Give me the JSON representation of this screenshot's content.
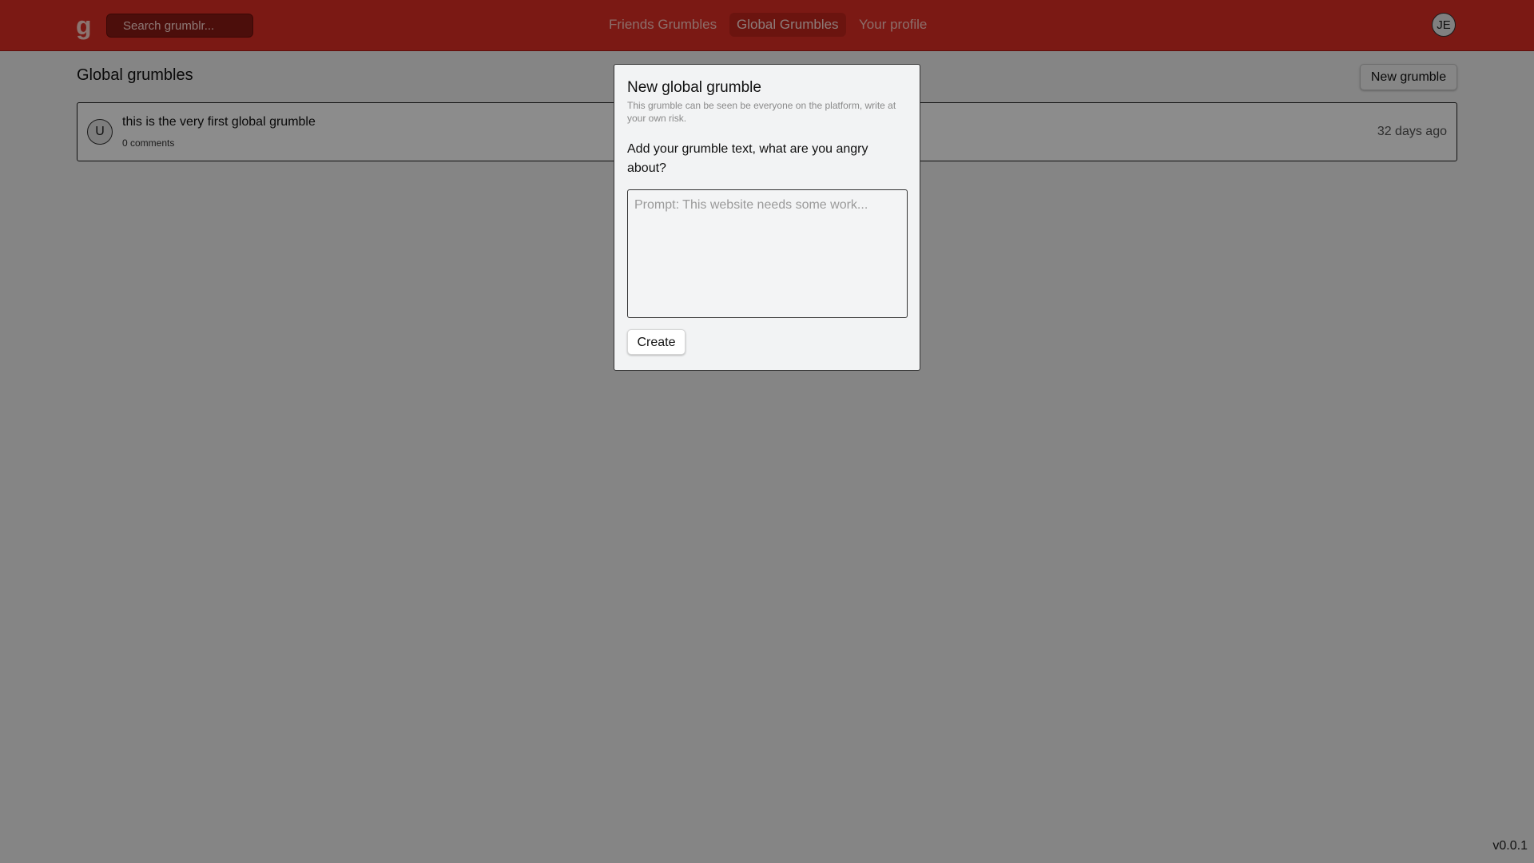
{
  "header": {
    "logo": "g",
    "search_placeholder": "Search grumblr...",
    "nav": [
      {
        "label": "Friends Grumbles",
        "active": false
      },
      {
        "label": "Global Grumbles",
        "active": true
      },
      {
        "label": "Your profile",
        "active": false
      }
    ],
    "user_initials": "JE"
  },
  "main": {
    "title": "Global grumbles",
    "new_button_label": "New grumble",
    "posts": [
      {
        "avatar_initial": "U",
        "text": "this is the very first global grumble",
        "comments": "0 comments",
        "time": "32 days ago"
      }
    ]
  },
  "modal": {
    "title": "New global grumble",
    "subtitle": "This grumble can be seen be everyone on the platform, write at your own risk.",
    "label": "Add your grumble text, what are you angry about?",
    "placeholder": "Prompt: This website needs some work...",
    "value": "",
    "create_label": "Create"
  },
  "footer": {
    "version": "v0.0.1"
  },
  "colors": {
    "header_bg": "#e02f26",
    "overlay": "rgba(0,0,0,0.45)"
  }
}
